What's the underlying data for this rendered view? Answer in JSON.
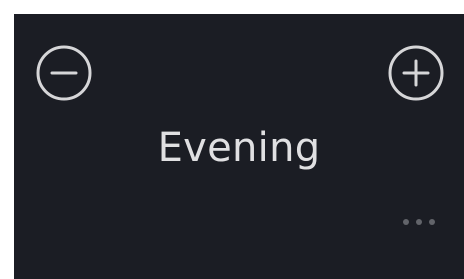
{
  "scene": {
    "title": "Evening"
  },
  "controls": {
    "decrease_icon": "minus-circle-icon",
    "increase_icon": "plus-circle-icon",
    "more_icon": "more-horizontal-icon"
  },
  "colors": {
    "tile_background": "#1b1d24",
    "icon_stroke": "#d6d6d8",
    "title_text": "#e0e0e2",
    "more_dots": "#62646a",
    "page_background": "#ffffff"
  }
}
